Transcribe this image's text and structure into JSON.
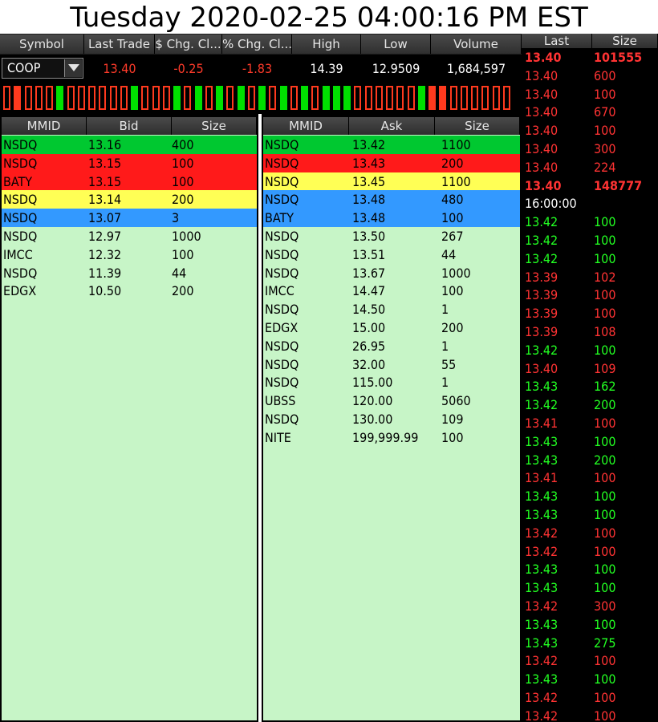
{
  "title": "Tuesday 2020-02-25 04:00:16 PM EST",
  "quote": {
    "headers": [
      "Symbol",
      "Last Trade",
      "$ Chg. Cl...",
      "% Chg. Cl...",
      "High",
      "Low",
      "Volume"
    ],
    "symbol": "COOP",
    "last_trade": "13.40",
    "change": "-0.25",
    "pct_change": "-1.83",
    "high": "14.39",
    "low": "12.9509",
    "volume": "1,684,597"
  },
  "ticks": [
    "d",
    "df",
    "d",
    "d",
    "d",
    "uf",
    "d",
    "d",
    "d",
    "d",
    "d",
    "d",
    "uf",
    "d",
    "d",
    "d",
    "uf",
    "u",
    "uf",
    "u",
    "uf",
    "u",
    "uf",
    "u",
    "uf",
    "u",
    "uf",
    "u",
    "uf",
    "u",
    "uf",
    "uf",
    "uf",
    "u",
    "d",
    "d",
    "d",
    "u",
    "u",
    "uf",
    "df",
    "df",
    "d",
    "d",
    "d",
    "d",
    "d",
    "d"
  ],
  "colors": {
    "green_row": "#00c830",
    "red_row": "#ff1a1a",
    "yellow_row": "#ffff55",
    "blue_row": "#3399ff",
    "book_bg": "#c7f5c7",
    "ts_up": "#22ff22",
    "ts_down": "#ff3333"
  },
  "bid_book": {
    "headers": [
      "MMID",
      "Bid",
      "Size"
    ],
    "rows": [
      {
        "mmid": "NSDQ",
        "price": "13.16",
        "size": "400",
        "level": "green"
      },
      {
        "mmid": "NSDQ",
        "price": "13.15",
        "size": "100",
        "level": "red"
      },
      {
        "mmid": "BATY",
        "price": "13.15",
        "size": "100",
        "level": "red"
      },
      {
        "mmid": "NSDQ",
        "price": "13.14",
        "size": "200",
        "level": "yellow"
      },
      {
        "mmid": "NSDQ",
        "price": "13.07",
        "size": "3",
        "level": "blue"
      },
      {
        "mmid": "NSDQ",
        "price": "12.97",
        "size": "1000",
        "level": "none"
      },
      {
        "mmid": "IMCC",
        "price": "12.32",
        "size": "100",
        "level": "none"
      },
      {
        "mmid": "NSDQ",
        "price": "11.39",
        "size": "44",
        "level": "none"
      },
      {
        "mmid": "EDGX",
        "price": "10.50",
        "size": "200",
        "level": "none"
      }
    ]
  },
  "ask_book": {
    "headers": [
      "MMID",
      "Ask",
      "Size"
    ],
    "rows": [
      {
        "mmid": "NSDQ",
        "price": "13.42",
        "size": "1100",
        "level": "green"
      },
      {
        "mmid": "NSDQ",
        "price": "13.43",
        "size": "200",
        "level": "red"
      },
      {
        "mmid": "NSDQ",
        "price": "13.45",
        "size": "1100",
        "level": "yellow"
      },
      {
        "mmid": "NSDQ",
        "price": "13.48",
        "size": "480",
        "level": "blue"
      },
      {
        "mmid": "BATY",
        "price": "13.48",
        "size": "100",
        "level": "blue"
      },
      {
        "mmid": "NSDQ",
        "price": "13.50",
        "size": "267",
        "level": "none"
      },
      {
        "mmid": "NSDQ",
        "price": "13.51",
        "size": "44",
        "level": "none"
      },
      {
        "mmid": "NSDQ",
        "price": "13.67",
        "size": "1000",
        "level": "none"
      },
      {
        "mmid": "IMCC",
        "price": "14.47",
        "size": "100",
        "level": "none"
      },
      {
        "mmid": "NSDQ",
        "price": "14.50",
        "size": "1",
        "level": "none"
      },
      {
        "mmid": "EDGX",
        "price": "15.00",
        "size": "200",
        "level": "none"
      },
      {
        "mmid": "NSDQ",
        "price": "26.95",
        "size": "1",
        "level": "none"
      },
      {
        "mmid": "NSDQ",
        "price": "32.00",
        "size": "55",
        "level": "none"
      },
      {
        "mmid": "NSDQ",
        "price": "115.00",
        "size": "1",
        "level": "none"
      },
      {
        "mmid": "UBSS",
        "price": "120.00",
        "size": "5060",
        "level": "none"
      },
      {
        "mmid": "NSDQ",
        "price": "130.00",
        "size": "109",
        "level": "none"
      },
      {
        "mmid": "NITE",
        "price": "199,999.99",
        "size": "100",
        "level": "none"
      }
    ]
  },
  "time_sales": {
    "headers": [
      "Last",
      "Size"
    ],
    "rows": [
      {
        "last": "13.40",
        "size": "101555",
        "color": "down",
        "bold": true
      },
      {
        "last": "13.40",
        "size": "600",
        "color": "down"
      },
      {
        "last": "13.40",
        "size": "100",
        "color": "down"
      },
      {
        "last": "13.40",
        "size": "670",
        "color": "down"
      },
      {
        "last": "13.40",
        "size": "100",
        "color": "down"
      },
      {
        "last": "13.40",
        "size": "300",
        "color": "down"
      },
      {
        "last": "13.40",
        "size": "224",
        "color": "down"
      },
      {
        "last": "13.40",
        "size": "148777",
        "color": "down",
        "bold": true
      },
      {
        "last": "16:00:00",
        "size": "",
        "color": "white"
      },
      {
        "last": "13.42",
        "size": "100",
        "color": "up"
      },
      {
        "last": "13.42",
        "size": "100",
        "color": "up"
      },
      {
        "last": "13.42",
        "size": "100",
        "color": "up"
      },
      {
        "last": "13.39",
        "size": "102",
        "color": "down"
      },
      {
        "last": "13.39",
        "size": "100",
        "color": "down"
      },
      {
        "last": "13.39",
        "size": "100",
        "color": "down"
      },
      {
        "last": "13.39",
        "size": "108",
        "color": "down"
      },
      {
        "last": "13.42",
        "size": "100",
        "color": "up"
      },
      {
        "last": "13.40",
        "size": "109",
        "color": "down"
      },
      {
        "last": "13.43",
        "size": "162",
        "color": "up"
      },
      {
        "last": "13.42",
        "size": "200",
        "color": "up"
      },
      {
        "last": "13.41",
        "size": "100",
        "color": "down"
      },
      {
        "last": "13.43",
        "size": "100",
        "color": "up"
      },
      {
        "last": "13.43",
        "size": "200",
        "color": "up"
      },
      {
        "last": "13.41",
        "size": "100",
        "color": "down"
      },
      {
        "last": "13.43",
        "size": "100",
        "color": "up"
      },
      {
        "last": "13.43",
        "size": "100",
        "color": "up"
      },
      {
        "last": "13.42",
        "size": "100",
        "color": "down"
      },
      {
        "last": "13.42",
        "size": "100",
        "color": "down"
      },
      {
        "last": "13.43",
        "size": "100",
        "color": "up"
      },
      {
        "last": "13.43",
        "size": "100",
        "color": "up"
      },
      {
        "last": "13.42",
        "size": "300",
        "color": "down"
      },
      {
        "last": "13.43",
        "size": "100",
        "color": "up"
      },
      {
        "last": "13.43",
        "size": "275",
        "color": "up"
      },
      {
        "last": "13.42",
        "size": "100",
        "color": "down"
      },
      {
        "last": "13.43",
        "size": "100",
        "color": "up"
      },
      {
        "last": "13.42",
        "size": "100",
        "color": "down"
      },
      {
        "last": "13.42",
        "size": "100",
        "color": "down"
      }
    ]
  }
}
